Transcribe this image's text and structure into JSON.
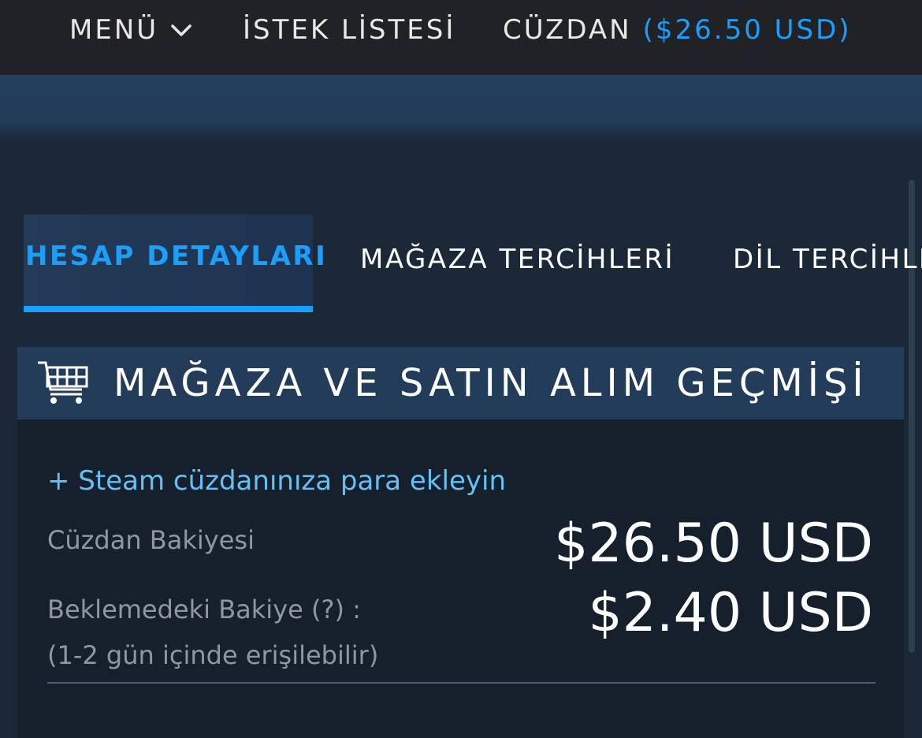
{
  "topbar": {
    "menu_label": "MENÜ",
    "wishlist_label": "İSTEK LİSTESİ",
    "wallet_label": "CÜZDAN",
    "wallet_amount": "($26.50 USD)"
  },
  "tabs": [
    {
      "label": "HESAP DETAYLARI",
      "active": true
    },
    {
      "label": "MAĞAZA TERCİHLERİ",
      "active": false
    },
    {
      "label": "DİL TERCİHLERİ",
      "active": false
    }
  ],
  "panel": {
    "title": "MAĞAZA VE SATIN ALIM GEÇMİŞİ",
    "icon": "shopping-cart-icon",
    "add_funds_link": "+ Steam cüzdanınıza para ekleyin",
    "balance_label": "Cüzdan Bakiyesi",
    "balance_value": "$26.50 USD",
    "pending_label": "Beklemedeki Bakiye (?) :",
    "pending_note": "(1-2 gün içinde erişilebilir)",
    "pending_value": "$2.40 USD"
  },
  "colors": {
    "accent": "#1a9fff",
    "link": "#66c0f4",
    "topbar_bg": "#212226",
    "page_bg": "#1b2838",
    "panel_header_bg": "#223c5a"
  }
}
